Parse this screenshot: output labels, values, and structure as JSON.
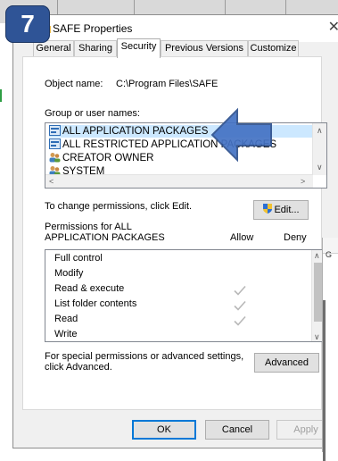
{
  "step_badge": "7",
  "window": {
    "title": "SAFE Properties",
    "close_glyph": "✕"
  },
  "tabs": [
    {
      "label": "General",
      "active": false
    },
    {
      "label": "Sharing",
      "active": false
    },
    {
      "label": "Security",
      "active": true
    },
    {
      "label": "Previous Versions",
      "active": false
    },
    {
      "label": "Customize",
      "active": false
    }
  ],
  "security": {
    "object_name_label": "Object name:",
    "object_name_value": "C:\\Program Files\\SAFE",
    "group_label": "Group or user names:",
    "groups": [
      {
        "name": "ALL APPLICATION PACKAGES",
        "icon": "app-package-icon",
        "selected": true
      },
      {
        "name": "ALL RESTRICTED APPLICATION PACKAGES",
        "icon": "app-package-icon",
        "selected": false
      },
      {
        "name": "CREATOR OWNER",
        "icon": "users-icon",
        "selected": false
      },
      {
        "name": "SYSTEM",
        "icon": "users-icon",
        "selected": false
      }
    ],
    "change_text": "To change permissions, click Edit.",
    "edit_button": "Edit...",
    "permissions_for": "Permissions for ALL\nAPPLICATION PACKAGES",
    "allow_header": "Allow",
    "deny_header": "Deny",
    "permissions": [
      {
        "name": "Full control",
        "allow": false
      },
      {
        "name": "Modify",
        "allow": false
      },
      {
        "name": "Read & execute",
        "allow": true
      },
      {
        "name": "List folder contents",
        "allow": true
      },
      {
        "name": "Read",
        "allow": true
      },
      {
        "name": "Write",
        "allow": false
      }
    ],
    "advanced_text": "For special permissions or advanced settings,\nclick Advanced.",
    "advanced_button": "Advanced"
  },
  "footer": {
    "ok": "OK",
    "cancel": "Cancel",
    "apply": "Apply"
  },
  "background_window_letter": "G",
  "colors": {
    "badge": "#2f5496",
    "arrow": "#4472c4",
    "selection": "#cce8ff",
    "focus_border": "#0078d7"
  }
}
